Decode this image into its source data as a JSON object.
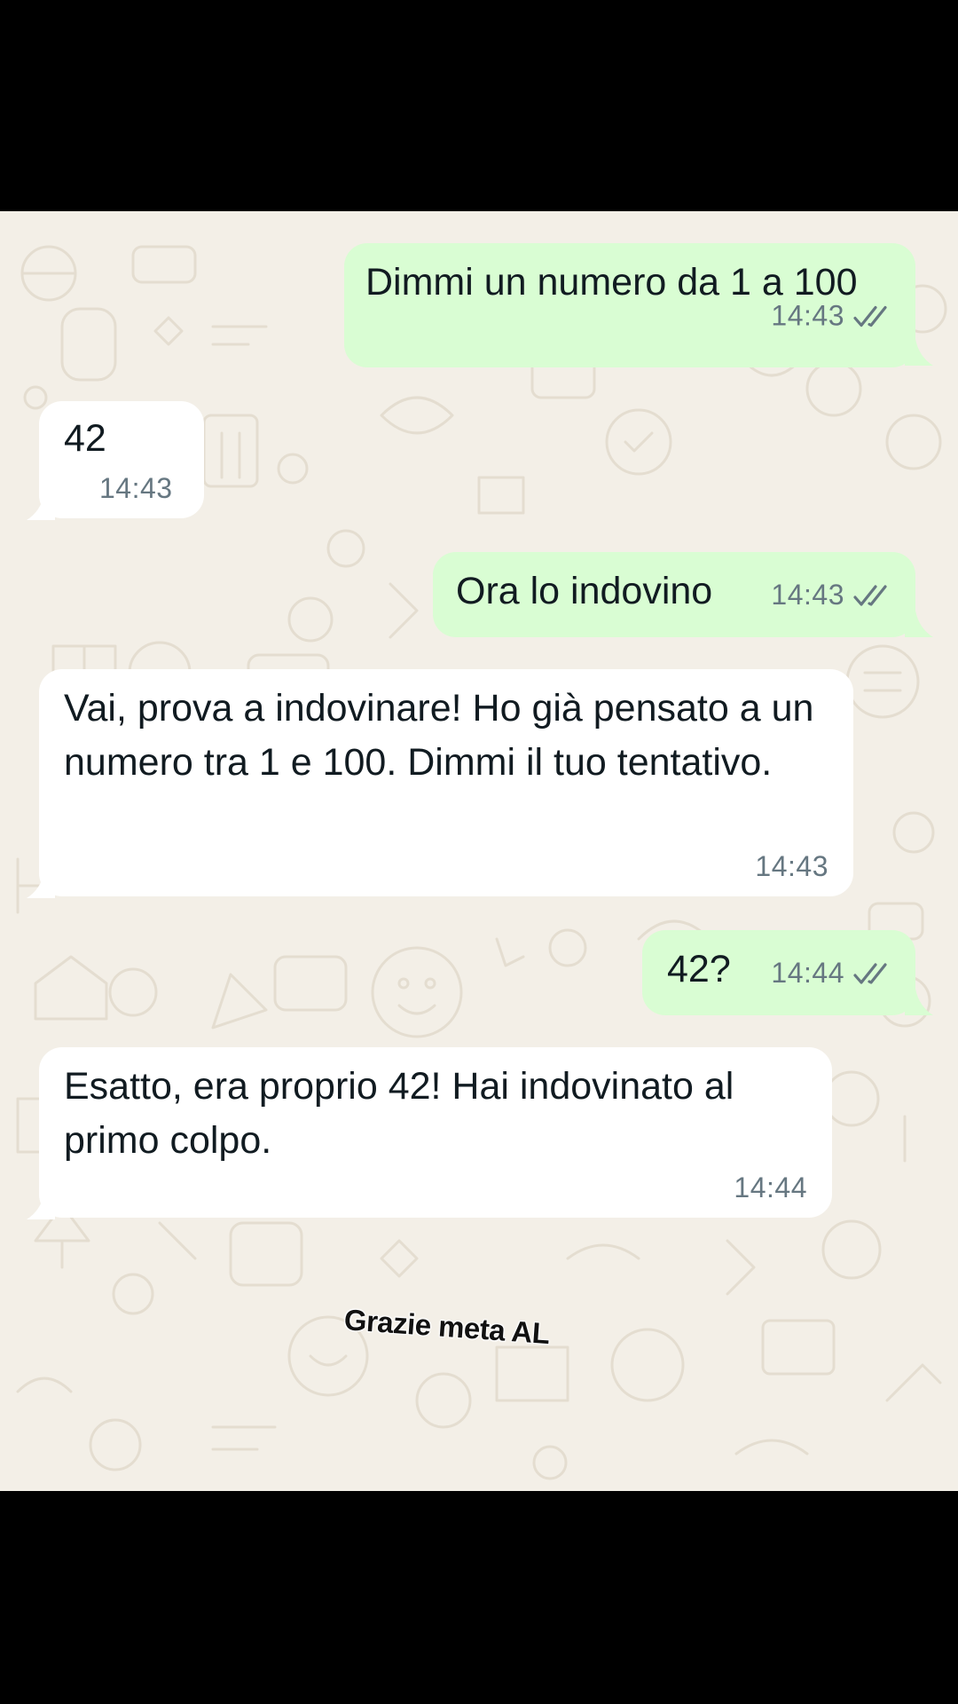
{
  "theme": {
    "chat_background": "#f3efe7",
    "outgoing_bubble": "#d9fdd3",
    "incoming_bubble": "#ffffff",
    "text_color": "#111b21",
    "meta_color": "#667781"
  },
  "messages": [
    {
      "direction": "outgoing",
      "text": "Dimmi un numero da 1 a 100",
      "time": "14:43",
      "status_icon": "double-check-icon"
    },
    {
      "direction": "incoming",
      "text": "42",
      "time": "14:43"
    },
    {
      "direction": "outgoing",
      "text": "Ora lo indovino",
      "time": "14:43",
      "status_icon": "double-check-icon"
    },
    {
      "direction": "incoming",
      "text": "Vai, prova a indovinare! Ho già pensato a un numero tra 1 e 100. Dimmi il tuo tentativo.",
      "time": "14:43"
    },
    {
      "direction": "outgoing",
      "text": "42?",
      "time": "14:44",
      "status_icon": "double-check-icon"
    },
    {
      "direction": "incoming",
      "text": "Esatto, era proprio 42! Hai indovinato al primo colpo.",
      "time": "14:44"
    }
  ],
  "overlay_caption": "Grazie meta AL"
}
